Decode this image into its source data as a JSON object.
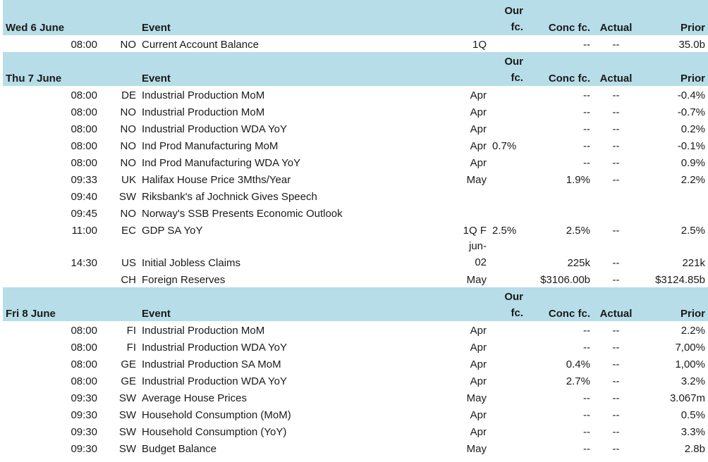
{
  "columns": {
    "event": "Event",
    "our_fc_line1": "Our",
    "our_fc_line2": "fc.",
    "conc_fc": "Conc fc.",
    "actual": "Actual",
    "prior": "Prior"
  },
  "days": [
    {
      "label": "Wed 6 June",
      "rows": [
        {
          "time": "08:00",
          "country": "NO",
          "event": "Current Account Balance",
          "period": "1Q",
          "our_fc": "",
          "conc_fc": "--",
          "actual": "--",
          "prior": "35.0b"
        }
      ]
    },
    {
      "label": "Thu 7 June",
      "rows": [
        {
          "time": "08:00",
          "country": "DE",
          "event": "Industrial Production MoM",
          "period": "Apr",
          "our_fc": "",
          "conc_fc": "--",
          "actual": "--",
          "prior": "-0.4%"
        },
        {
          "time": "08:00",
          "country": "NO",
          "event": "Industrial Production MoM",
          "period": "Apr",
          "our_fc": "",
          "conc_fc": "--",
          "actual": "--",
          "prior": "-0.7%"
        },
        {
          "time": "08:00",
          "country": "NO",
          "event": "Industrial Production WDA YoY",
          "period": "Apr",
          "our_fc": "",
          "conc_fc": "--",
          "actual": "--",
          "prior": "0.2%"
        },
        {
          "time": "08:00",
          "country": "NO",
          "event": "Ind Prod Manufacturing MoM",
          "period": "Apr",
          "our_fc": "0.7%",
          "conc_fc": "--",
          "actual": "--",
          "prior": "-0.1%"
        },
        {
          "time": "08:00",
          "country": "NO",
          "event": "Ind Prod Manufacturing WDA YoY",
          "period": "Apr",
          "our_fc": "",
          "conc_fc": "--",
          "actual": "--",
          "prior": "0.9%"
        },
        {
          "time": "09:33",
          "country": "UK",
          "event": "Halifax House Price 3Mths/Year",
          "period": "May",
          "our_fc": "",
          "conc_fc": "1.9%",
          "actual": "--",
          "prior": "2.2%"
        },
        {
          "time": "09:40",
          "country": "SW",
          "event": "Riksbank's af Jochnick Gives Speech",
          "period": "",
          "our_fc": "",
          "conc_fc": "",
          "actual": "",
          "prior": ""
        },
        {
          "time": "09:45",
          "country": "NO",
          "event": "Norway's SSB Presents Economic Outlook",
          "period": "",
          "our_fc": "",
          "conc_fc": "",
          "actual": "",
          "prior": ""
        },
        {
          "time": "11:00",
          "country": "EC",
          "event": "GDP SA YoY",
          "period": "1Q F",
          "our_fc": "2.5%",
          "conc_fc": "2.5%",
          "actual": "--",
          "prior": "2.5%"
        },
        {
          "time": "14:30",
          "country": "US",
          "event": "Initial Jobless Claims",
          "period_line1": "jun-",
          "period": "02",
          "our_fc": "",
          "conc_fc": "225k",
          "actual": "--",
          "prior": "221k",
          "tall": true
        },
        {
          "time": "",
          "country": "CH",
          "event": "Foreign Reserves",
          "period": "May",
          "our_fc": "",
          "conc_fc": "$3106.00b",
          "actual": "--",
          "prior": "$3124.85b"
        }
      ]
    },
    {
      "label": "Fri 8 June",
      "rows": [
        {
          "time": "08:00",
          "country": "FI",
          "event": "Industrial Production MoM",
          "period": "Apr",
          "our_fc": "",
          "conc_fc": "--",
          "actual": "--",
          "prior": "2.2%"
        },
        {
          "time": "08:00",
          "country": "FI",
          "event": "Industrial Production WDA YoY",
          "period": "Apr",
          "our_fc": "",
          "conc_fc": "--",
          "actual": "--",
          "prior": "7,00%"
        },
        {
          "time": "08:00",
          "country": "GE",
          "event": "Industrial Production SA MoM",
          "period": "Apr",
          "our_fc": "",
          "conc_fc": "0.4%",
          "actual": "--",
          "prior": "1,00%"
        },
        {
          "time": "08:00",
          "country": "GE",
          "event": "Industrial Production WDA YoY",
          "period": "Apr",
          "our_fc": "",
          "conc_fc": "2.7%",
          "actual": "--",
          "prior": "3.2%"
        },
        {
          "time": "09:30",
          "country": "SW",
          "event": "Average House Prices",
          "period": "May",
          "our_fc": "",
          "conc_fc": "--",
          "actual": "--",
          "prior": "3.067m"
        },
        {
          "time": "09:30",
          "country": "SW",
          "event": "Household Consumption (MoM)",
          "period": "Apr",
          "our_fc": "",
          "conc_fc": "--",
          "actual": "--",
          "prior": "0.5%"
        },
        {
          "time": "09:30",
          "country": "SW",
          "event": "Household Consumption (YoY)",
          "period": "Apr",
          "our_fc": "",
          "conc_fc": "--",
          "actual": "--",
          "prior": "3.3%"
        },
        {
          "time": "09:30",
          "country": "SW",
          "event": "Budget Balance",
          "period": "May",
          "our_fc": "",
          "conc_fc": "--",
          "actual": "--",
          "prior": "2.8b"
        }
      ]
    }
  ]
}
